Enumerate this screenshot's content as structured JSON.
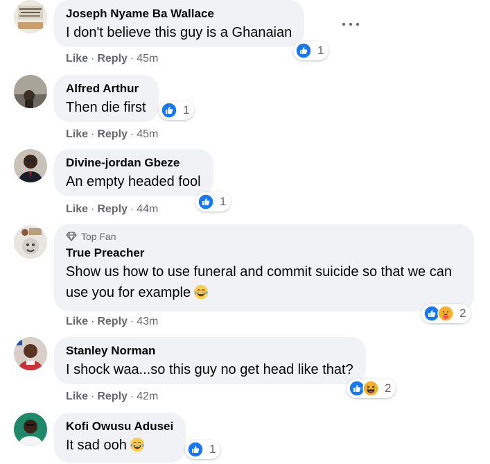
{
  "labels": {
    "like": "Like",
    "reply": "Reply",
    "dot": "·",
    "top_fan": "Top Fan"
  },
  "colors": {
    "like_blue": "#1877f2",
    "bubble": "#f0f2f5",
    "meta_grey": "#65676b"
  },
  "comments": [
    {
      "author": "Joseph Nyame Ba Wallace",
      "text": "I don't believe this guy is a Ghanaian",
      "time": "45m",
      "reactions": [
        "like"
      ],
      "reaction_count": "1",
      "has_more_menu": true
    },
    {
      "author": "Alfred Arthur",
      "text": "Then die first",
      "time": "45m",
      "reactions": [
        "like"
      ],
      "reaction_count": "1"
    },
    {
      "author": "Divine-jordan Gbeze",
      "text": "An empty headed fool",
      "time": "44m",
      "reactions": [
        "like"
      ],
      "reaction_count": "1"
    },
    {
      "author": "True Preacher",
      "badge": "Top Fan",
      "text": "Show us how to use funeral and commit suicide so that we can use you for example",
      "text_emoji": "laughing-tears",
      "time": "43m",
      "reactions": [
        "like",
        "care"
      ],
      "reaction_count": "2"
    },
    {
      "author": "Stanley Norman",
      "text": "I shock waa...so this guy no get head like that?",
      "time": "42m",
      "reactions": [
        "like",
        "haha"
      ],
      "reaction_count": "2"
    },
    {
      "author": "Kofi Owusu Adusei",
      "text": "It sad ooh",
      "text_emoji": "laughing-tears",
      "time": "",
      "reactions": [
        "like"
      ],
      "reaction_count": "1"
    }
  ]
}
